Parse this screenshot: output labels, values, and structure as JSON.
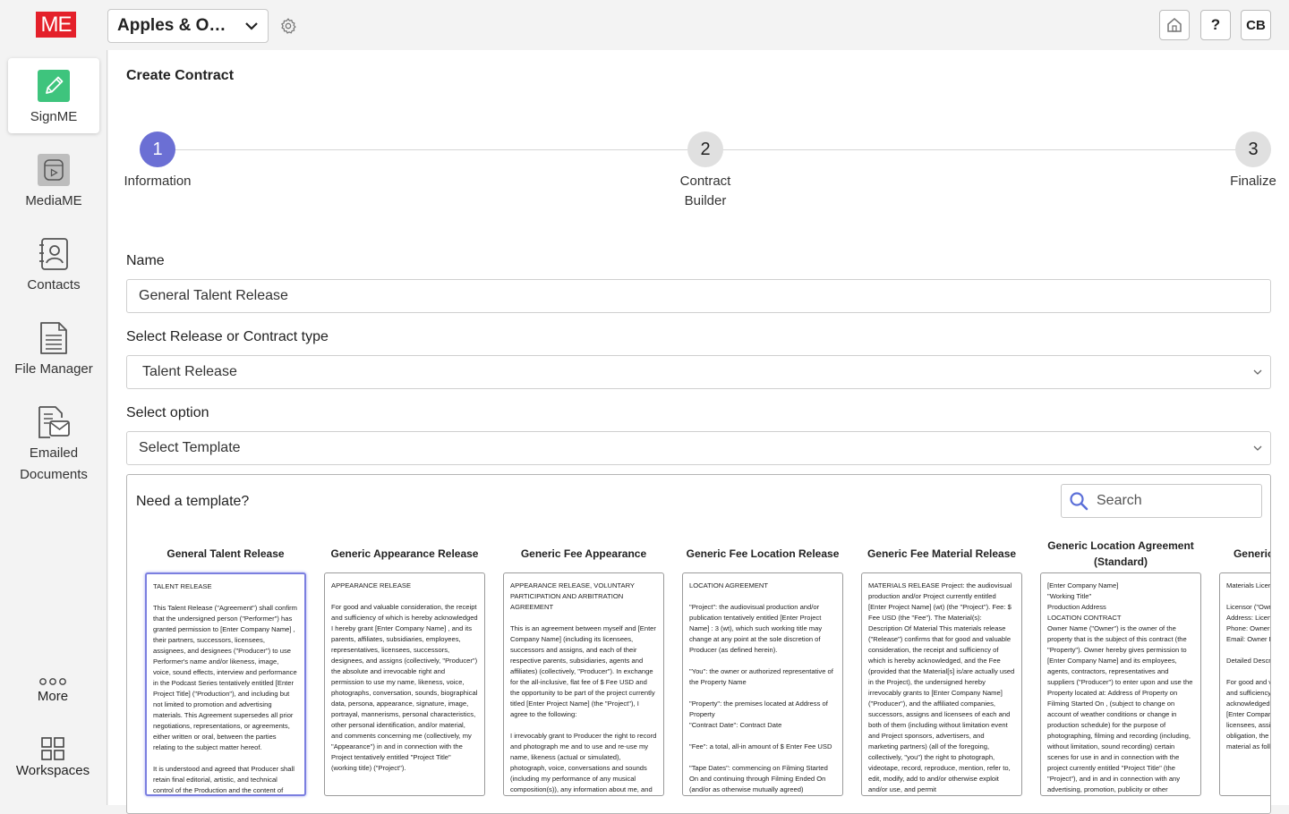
{
  "app": {
    "logo": "ME",
    "workspace": "Apples & Oranges"
  },
  "topbar": {
    "help_label": "?",
    "user_initials": "CB"
  },
  "sidebar": {
    "items": [
      {
        "label": "SignME"
      },
      {
        "label": "MediaME"
      },
      {
        "label": "Contacts"
      },
      {
        "label": "File Manager"
      },
      {
        "label": "Emailed Documents"
      }
    ],
    "more_label": "More",
    "workspaces_label": "Workspaces"
  },
  "page": {
    "title": "Create Contract"
  },
  "stepper": [
    {
      "number": "1",
      "label": "Information"
    },
    {
      "number": "2",
      "label": "Contract Builder"
    },
    {
      "number": "3",
      "label": "Finalize"
    }
  ],
  "form": {
    "name_label": "Name",
    "name_value": "General Talent Release",
    "type_label": "Select Release or Contract type",
    "type_value": "Talent Release",
    "option_label": "Select option",
    "option_value": "Select Template"
  },
  "templates": {
    "title": "Need a template?",
    "search_placeholder": "Search",
    "cards": [
      {
        "title": "General Talent Release",
        "paragraphs": [
          "TALENT RELEASE",
          "This Talent Release (\"Agreement\") shall confirm that the undersigned person (\"Performer\") has granted permission to [Enter Company Name] , their partners, successors, licensees, assignees, and designees (\"Producer\") to use Performer's name and/or likeness, image, voice, sound effects, interview and performance in the Podcast Series tentatively entitled [Enter Project Title] (\"Production\"), and including but not limited to promotion and advertising materials. This Agreement supersedes all prior negotiations, representations, or agreements, either written or oral, between the parties relating to the subject matter hereof.",
          "It is understood and agreed that Producer shall retain final editorial, artistic, and technical control of the Production and the content of"
        ]
      },
      {
        "title": "Generic Appearance Release",
        "paragraphs": [
          "APPEARANCE RELEASE",
          "For good and valuable consideration, the receipt and sufficiency of which is hereby acknowledged I hereby grant [Enter Company Name] , and its parents, affiliates, subsidiaries, employees, representatives, licensees, successors, designees, and assigns (collectively, \"Producer\") the absolute and irrevocable right and permission to use my name, likeness, voice, photographs, conversation, sounds, biographical data, persona, appearance, signature, image, portrayal, mannerisms, personal characteristics, other personal identification, and/or material, and comments concerning me (collectively, my \"Appearance\") in and in connection with the Project tentatively entitled \"Project Title\" (working title) (\"Project\")."
        ]
      },
      {
        "title": "Generic Fee Appearance",
        "paragraphs": [
          "APPEARANCE RELEASE, VOLUNTARY PARTICIPATION AND ARBITRATION AGREEMENT",
          "This is an agreement between myself and [Enter Company Name] (including its licensees, successors and assigns, and each of their respective parents, subsidiaries, agents and affiliates) (collectively, \"Producer\"). In exchange for the all-inclusive, flat fee of $ Fee USD and the opportunity to be part of the project currently titled [Enter Project Name] (the \"Project\"), I agree to the following:",
          "I irrevocably grant to Producer the right to record and photograph me and to use and re-use my name, likeness (actual or simulated), photograph, voice, conversations and sounds (including my performance of any musical composition(s)), any information about me, and"
        ]
      },
      {
        "title": "Generic Fee Location Release",
        "paragraphs": [
          "LOCATION AGREEMENT",
          "\"Project\": the audiovisual production and/or publication tentatively entitled [Enter Project Name] : 3 (wt), which such working title may change at any point at the sole discretion of Producer (as defined herein).",
          "\"You\": the owner or authorized representative of the Property Name",
          "\"Property\": the premises located at Address of Property\n\"Contract Date\": Contract Date",
          "\"Fee\": a total, all-in amount of $ Enter Fee USD",
          "\"Tape Dates\": commencing on Filming Started On and continuing through Filming Ended On (and/or as otherwise mutually agreed)"
        ]
      },
      {
        "title": "Generic Fee Material Release",
        "paragraphs": [
          "MATERIALS RELEASE          Project: the audiovisual production and/or Project currently entitled [Enter Project Name] (wt) (the \"Project\").     Fee: $ Fee USD (the \"Fee\"). The Material(s): Description Of Material This materials release (\"Release\") confirms that for good and valuable consideration, the receipt and sufficiency of which is hereby acknowledged, and the Fee (provided that the Material[s] is/are actually used in the Project), the undersigned hereby irrevocably grants to [Enter Company Name] (\"Producer\"), and the affiliated companies, successors, assigns and licensees of each and both of them (including without limitation event and Project sponsors, advertisers, and marketing partners) (all of the foregoing, collectively, \"you\") the right to photograph, videotape, record, reproduce, mention, refer to, edit, modify, add to and/or otherwise exploit and/or use, and permit"
        ]
      },
      {
        "title": "Generic Location Agreement (Standard)",
        "paragraphs": [
          "[Enter Company Name]\n\"Working Title\"\nProduction Address\nLOCATION CONTRACT\nOwner Name (\"Owner\") is the owner of the property that is the subject of this contract (the \"Property\"). Owner hereby gives permission to [Enter Company Name] and its employees, agents, contractors, representatives and suppliers (\"Producer\") to enter upon and use the Property located at: Address of Property on Filming Started On , (subject to change on account of weather conditions or change in production schedule) for the purpose of photographing, filming and recording (including, without limitation, sound recording) certain scenes for use in and in connection with the project currently entitled \"Project Title\" (the \"Project\"), and in and in connection with any advertising, promotion, publicity or other"
        ]
      },
      {
        "title": "Generic Materials License",
        "paragraphs": [
          "Materials License",
          "Licensor (\"Owner\")\nAddress: Licensor Address\nPhone: Owner Phone\nEmail: Owner Email",
          "Detailed Description Of Materials",
          "For good and valuable consideration, the receipt and sufficiency of which is hereby acknowledged, the undersigned hereby grants [Enter Company Name] and its respective licensees, assigns and designees, without obligation, the right to use the above-described material as follows (the \"Property\"):"
        ]
      }
    ]
  }
}
